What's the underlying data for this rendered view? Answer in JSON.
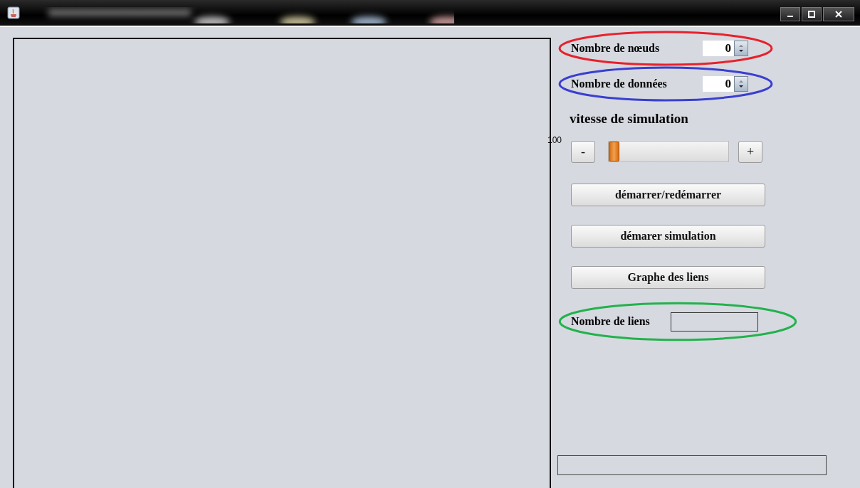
{
  "spinners": [
    {
      "label": "Nombre de nœuds",
      "value": "0",
      "color": "#e8212b"
    },
    {
      "label": "Nombre de données",
      "value": "0",
      "color": "#3a3fd0"
    }
  ],
  "speed": {
    "title": "vitesse de simulation",
    "value_label": "100",
    "decrement": "-",
    "increment": "+",
    "level": 0
  },
  "buttons": [
    "démarrer/redémarrer",
    "démarer simulation",
    "Graphe des liens"
  ],
  "links": {
    "label": "Nombre de liens",
    "color": "#22b24c"
  }
}
